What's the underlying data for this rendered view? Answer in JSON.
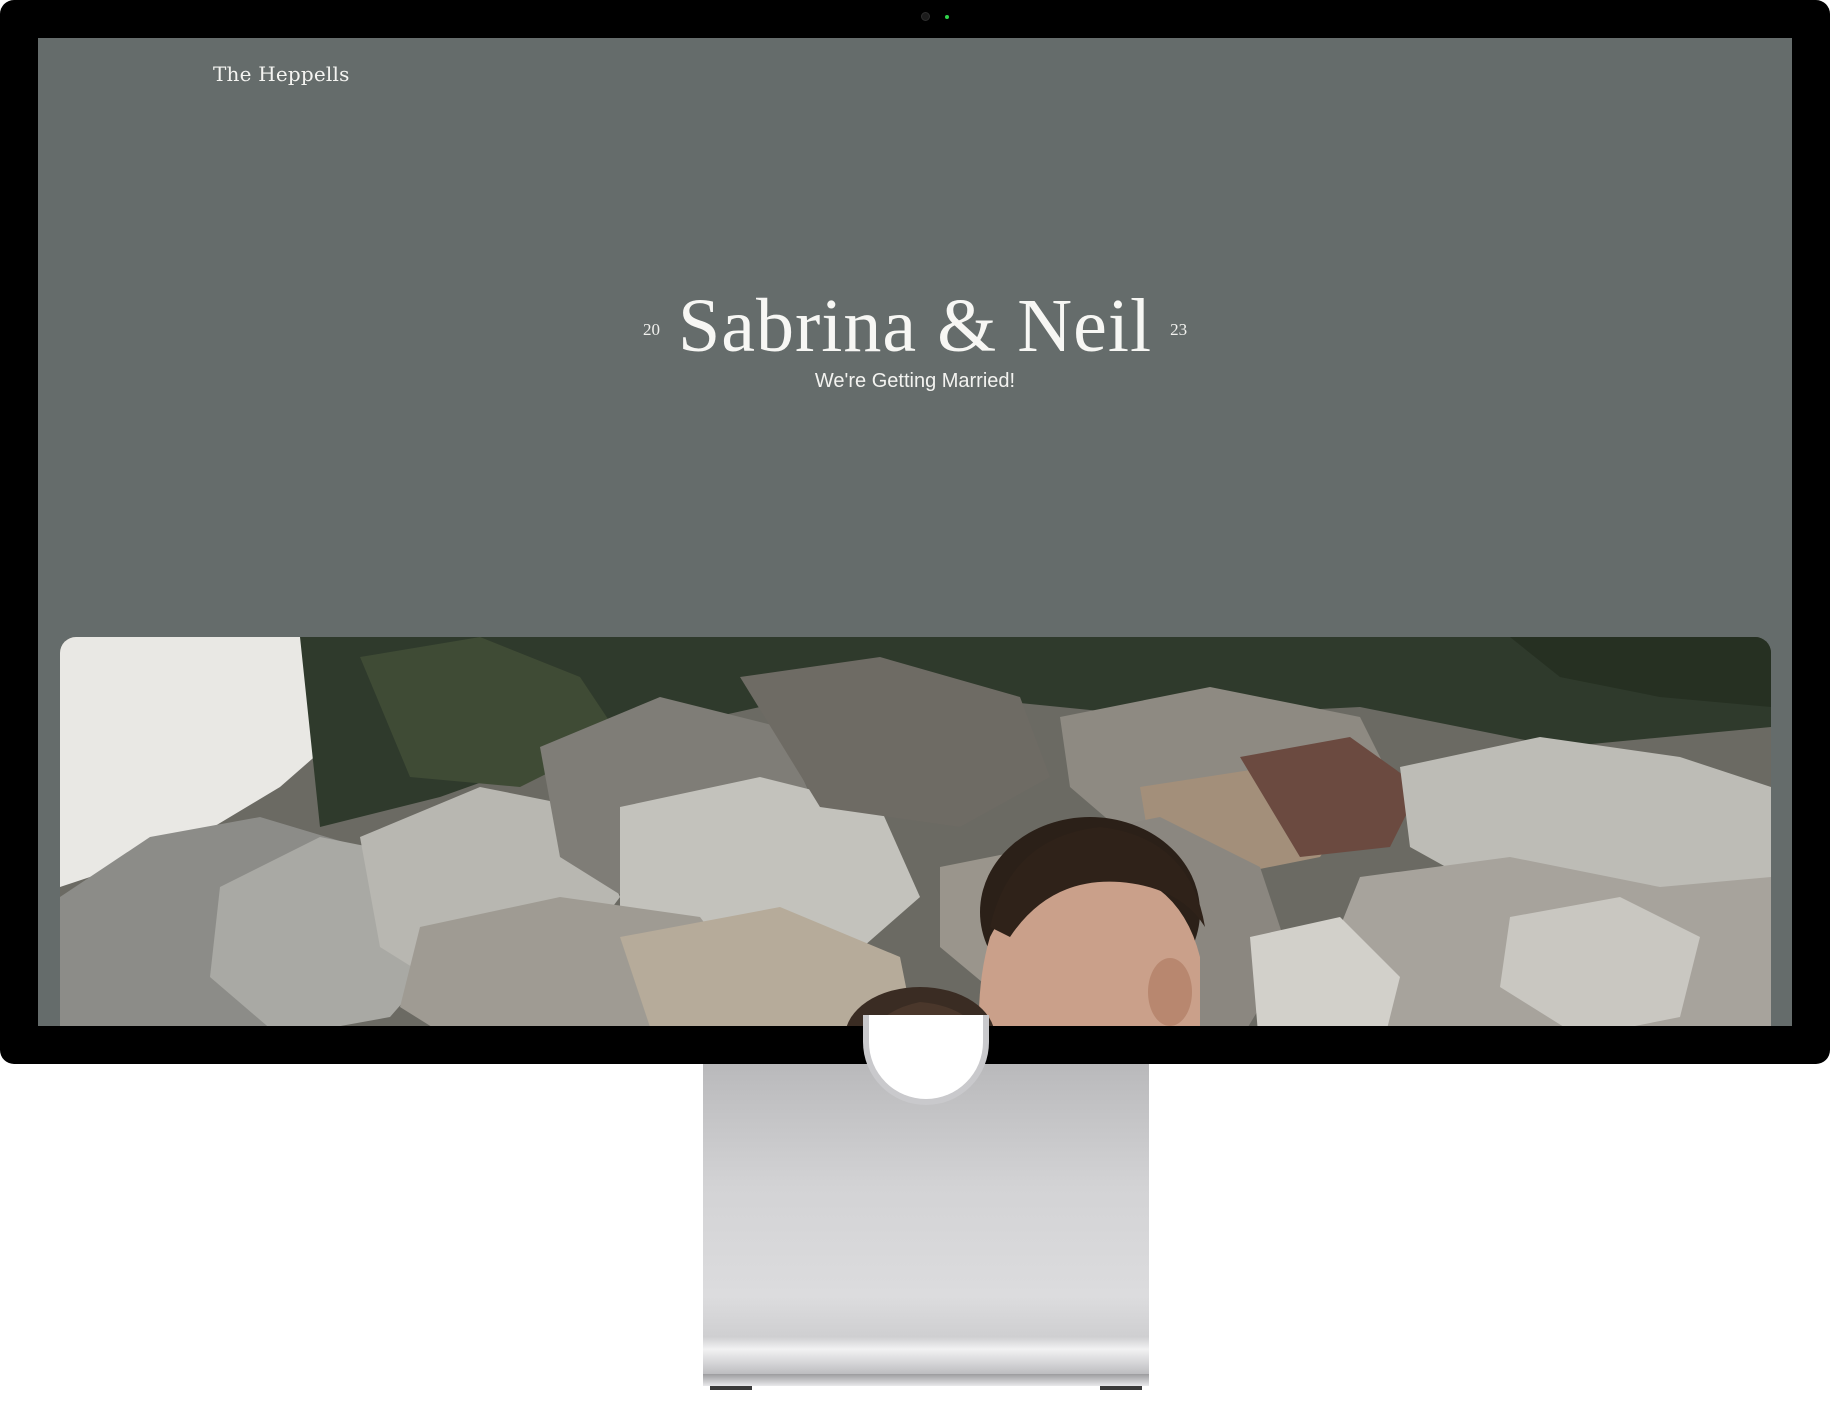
{
  "site": {
    "logo_text": "The Heppells"
  },
  "hero": {
    "year_left": "20",
    "year_right": "23",
    "names": "Sabrina & Neil",
    "tagline": "We're Getting Married!"
  },
  "photo": {
    "subject": "couple-on-rocky-shore"
  },
  "colors": {
    "background": "#656c6b",
    "text": "#f7f7f4",
    "bezel": "#000000"
  }
}
